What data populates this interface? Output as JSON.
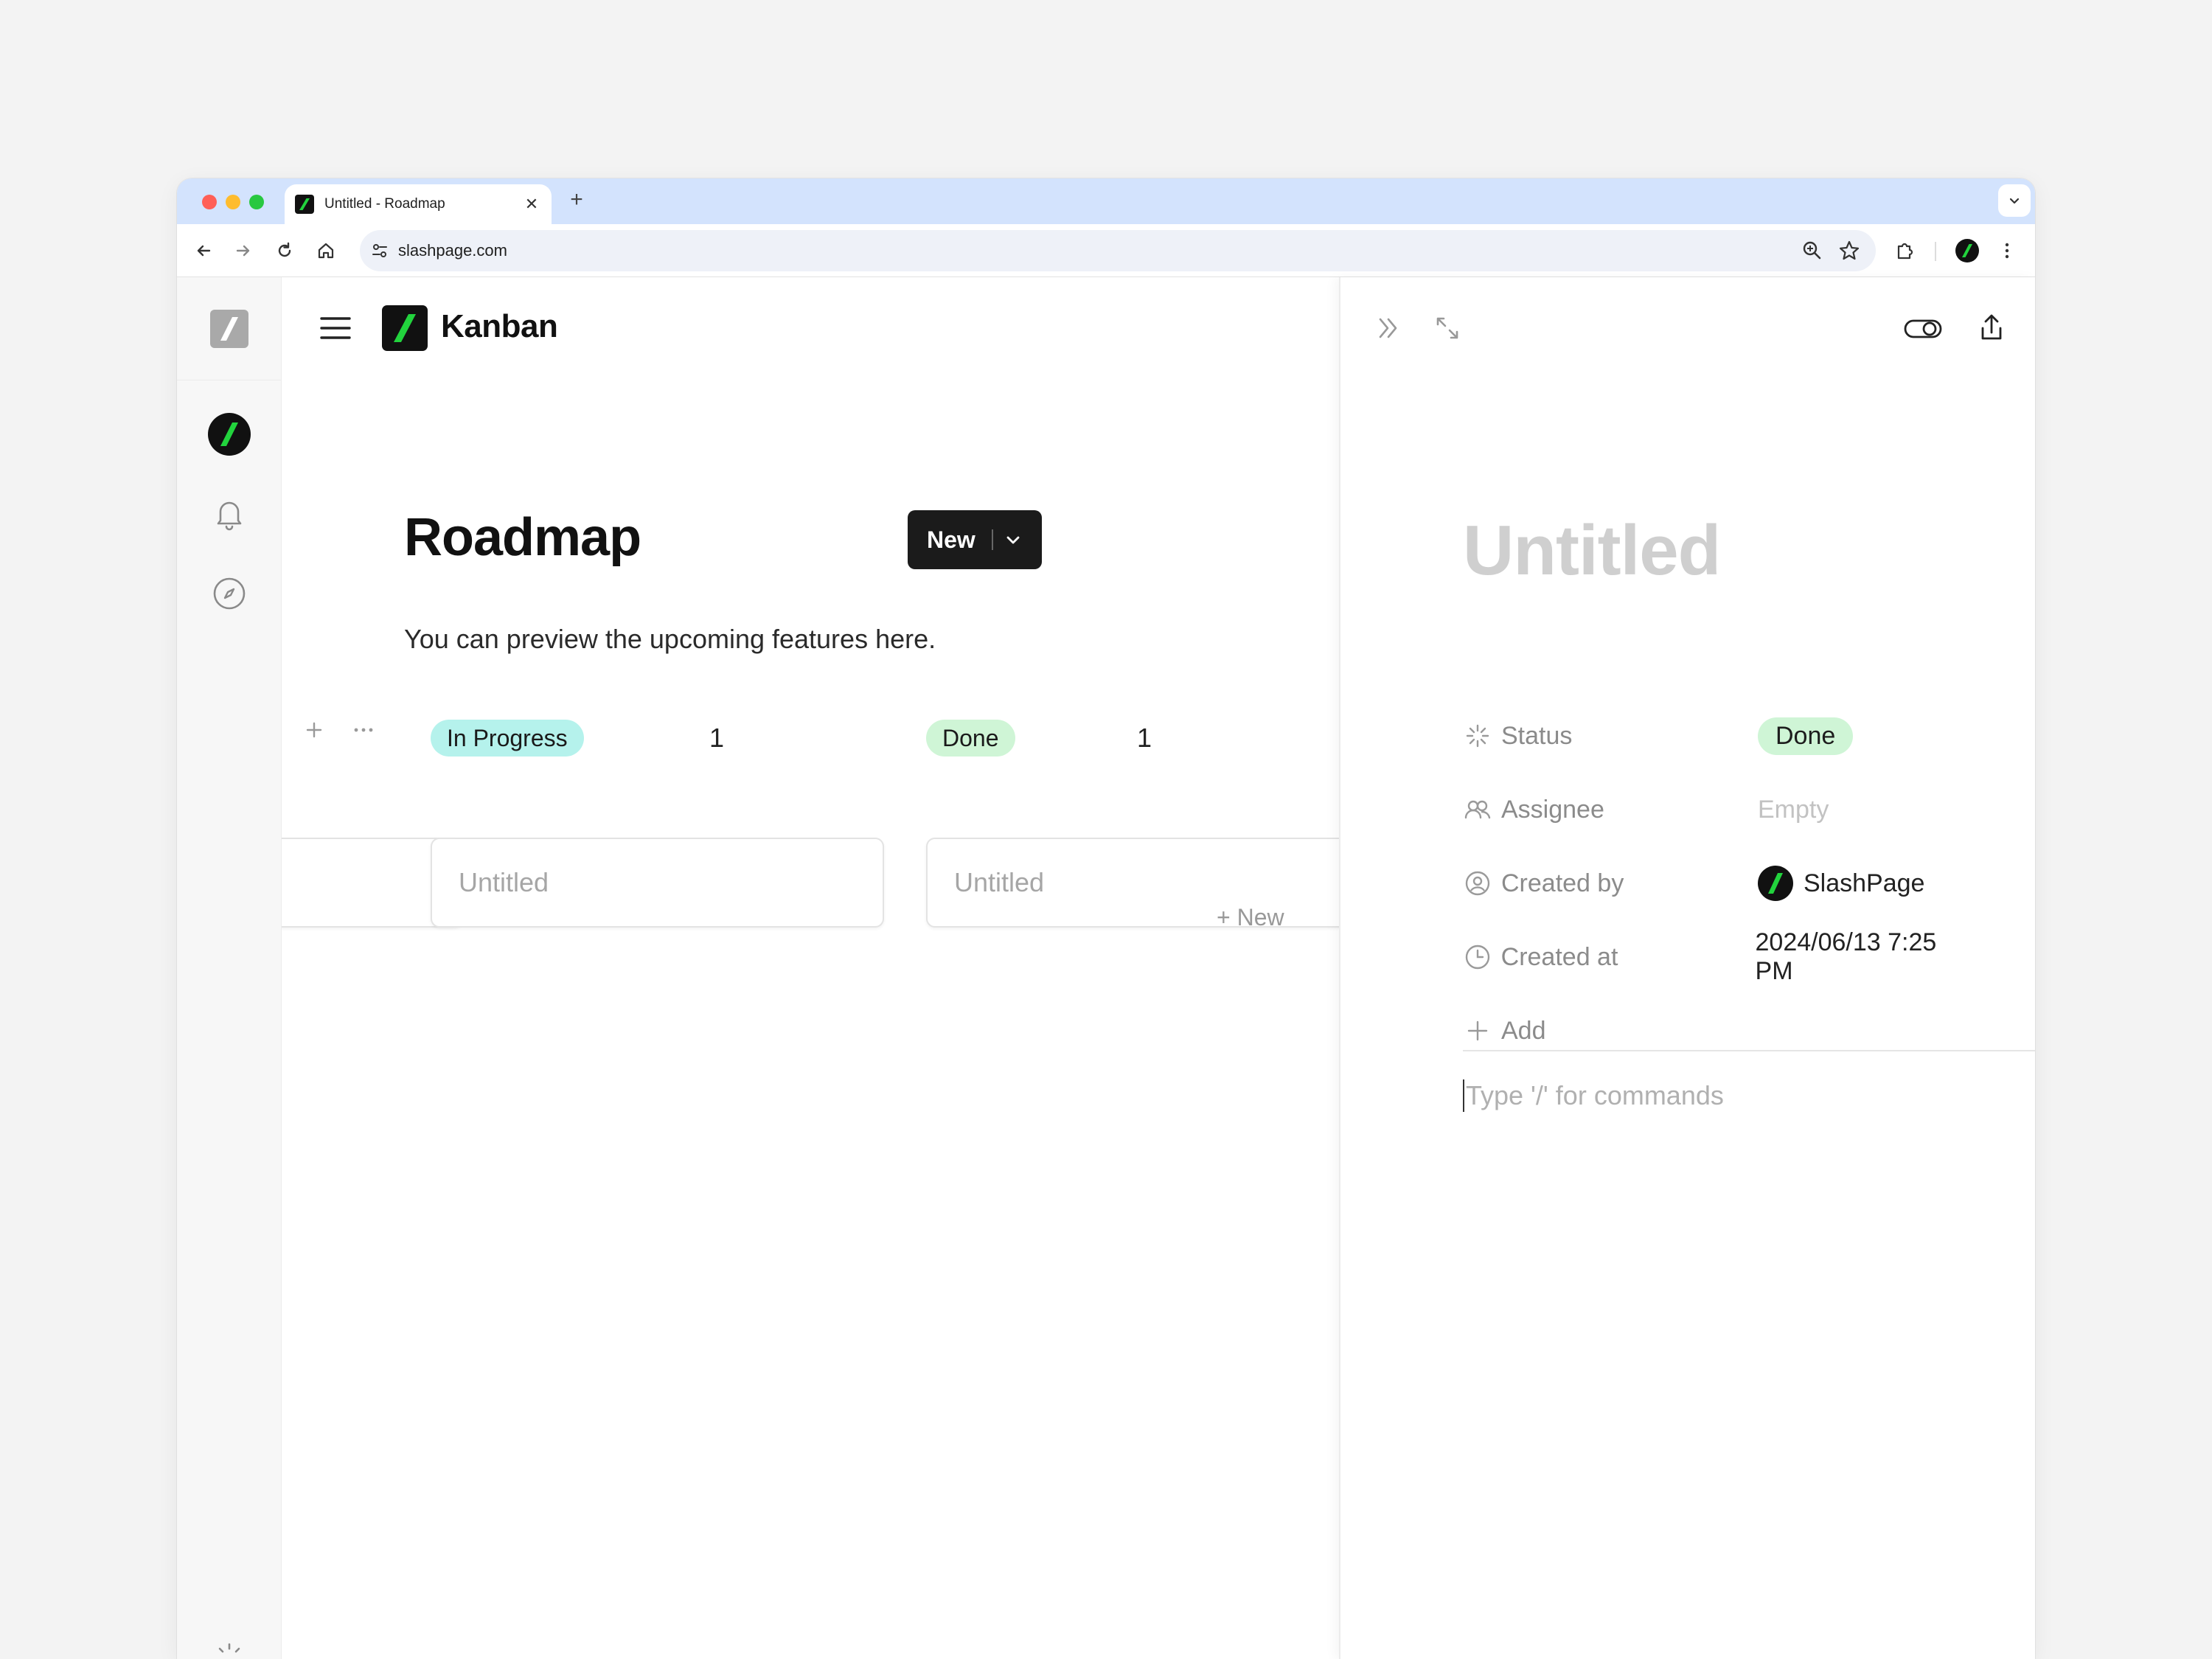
{
  "browser": {
    "tab_title": "Untitled - Roadmap",
    "tab_close": "✕",
    "new_tab": "+",
    "url": "slashpage.com",
    "traffic_lights": [
      "#ff5f57",
      "#febc2e",
      "#28c840"
    ]
  },
  "app": {
    "name": "Kanban",
    "brand_color": "#22d33d",
    "logo_bg": "#111111"
  },
  "rail": {
    "items": [
      "workspace-avatar",
      "notifications",
      "explore"
    ]
  },
  "page": {
    "title": "Roadmap",
    "description": "You can preview the upcoming features here.",
    "new_button": "New"
  },
  "board": {
    "columns": [
      {
        "label": "In Progress",
        "count": "1",
        "color": "#b5f2ec",
        "cards": [
          "Untitled"
        ]
      },
      {
        "label": "Done",
        "count": "1",
        "color": "#cff5d6",
        "cards": [
          "Untitled"
        ]
      }
    ],
    "add_new_hint": "+ New"
  },
  "detail": {
    "title": "Untitled",
    "properties": [
      {
        "name": "Status",
        "value": "Done",
        "icon": "status-icon"
      },
      {
        "name": "Assignee",
        "value": "Empty",
        "icon": "people-icon"
      },
      {
        "name": "Created by",
        "value": "SlashPage",
        "icon": "user-circle-icon"
      },
      {
        "name": "Created at",
        "value": "2024/06/13 7:25 PM",
        "icon": "clock-icon"
      }
    ],
    "add_property": "Add",
    "editor_placeholder": "Type '/' for commands"
  }
}
